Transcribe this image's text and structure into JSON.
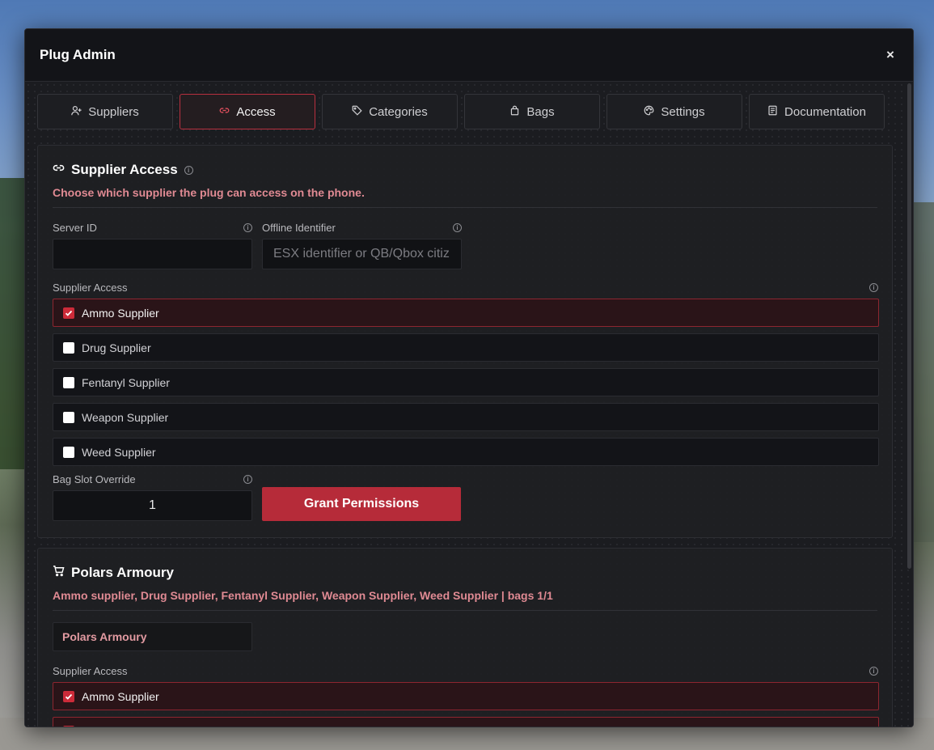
{
  "modal": {
    "title": "Plug Admin",
    "close": "×"
  },
  "tabs": [
    {
      "label": "Suppliers",
      "icon": "user-plus-icon"
    },
    {
      "label": "Access",
      "icon": "link-icon",
      "active": true
    },
    {
      "label": "Categories",
      "icon": "tag-icon"
    },
    {
      "label": "Bags",
      "icon": "bag-icon"
    },
    {
      "label": "Settings",
      "icon": "palette-icon"
    },
    {
      "label": "Documentation",
      "icon": "document-icon"
    }
  ],
  "access": {
    "title": "Supplier Access",
    "subtitle": "Choose which supplier the plug can access on the phone.",
    "server_id": {
      "label": "Server ID",
      "value": "",
      "placeholder": ""
    },
    "offline_identifier": {
      "label": "Offline Identifier",
      "value": "",
      "placeholder": "ESX identifier or QB/Qbox citiz"
    },
    "supplier_access_label": "Supplier Access",
    "suppliers": [
      {
        "label": "Ammo Supplier",
        "checked": true
      },
      {
        "label": "Drug Supplier",
        "checked": false
      },
      {
        "label": "Fentanyl Supplier",
        "checked": false
      },
      {
        "label": "Weapon Supplier",
        "checked": false
      },
      {
        "label": "Weed Supplier",
        "checked": false
      }
    ],
    "bag_slot_override": {
      "label": "Bag Slot Override",
      "value": "1"
    },
    "grant_button": "Grant Permissions"
  },
  "plug": {
    "title": "Polars Armoury",
    "summary": "Ammo supplier, Drug Supplier, Fentanyl Supplier, Weapon Supplier, Weed Supplier | bags 1/1",
    "name_value": "Polars Armoury",
    "supplier_access_label": "Supplier Access",
    "suppliers": [
      {
        "label": "Ammo Supplier",
        "checked": true
      },
      {
        "label": "",
        "checked": true
      }
    ]
  },
  "colors": {
    "accent": "#b62b39",
    "accent_text": "#e08a93",
    "background": "#15161a"
  }
}
